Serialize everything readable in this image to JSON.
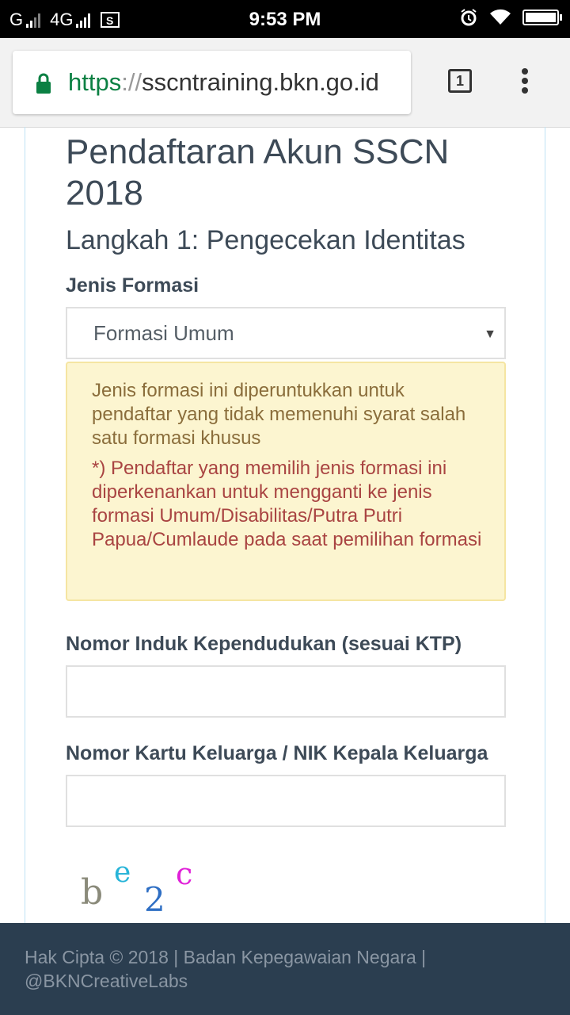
{
  "status_bar": {
    "carrier1": "G",
    "carrier2": "4G",
    "time": "9:53 PM",
    "battery_level": 1.0
  },
  "browser": {
    "url_scheme": "https",
    "url_sep": "://",
    "url_host": "sscntraining.bkn.go.id",
    "tab_count": "1"
  },
  "page": {
    "title": "Pendaftaran Akun SSCN 2018",
    "subtitle": "Langkah 1: Pengecekan Identitas",
    "jenis_formasi_label": "Jenis Formasi",
    "jenis_formasi_value": "Formasi Umum",
    "alert_info": "Jenis formasi ini diperuntukkan untuk pendaftar yang tidak memenuhi syarat salah satu formasi khusus",
    "alert_note": "*) Pendaftar yang memilih jenis formasi ini diperkenankan untuk mengganti ke jenis formasi Umum/Disabilitas/Putra Putri Papua/Cumlaude pada saat pemilihan formasi",
    "nik_label": "Nomor Induk Kependudukan (sesuai KTP)",
    "nik_value": "",
    "kk_label": "Nomor Kartu Keluarga / NIK Kepala Keluarga",
    "kk_value": "",
    "captcha_chars": [
      "b",
      "e",
      "2",
      "c"
    ]
  },
  "footer": {
    "text": "Hak Cipta © 2018 | Badan Kepegawaian Negara | @BKNCreativeLabs"
  },
  "colors": {
    "footer_bg": "#2b3e50",
    "alert_bg": "#fcf5d0",
    "secure_green": "#0b8043"
  }
}
